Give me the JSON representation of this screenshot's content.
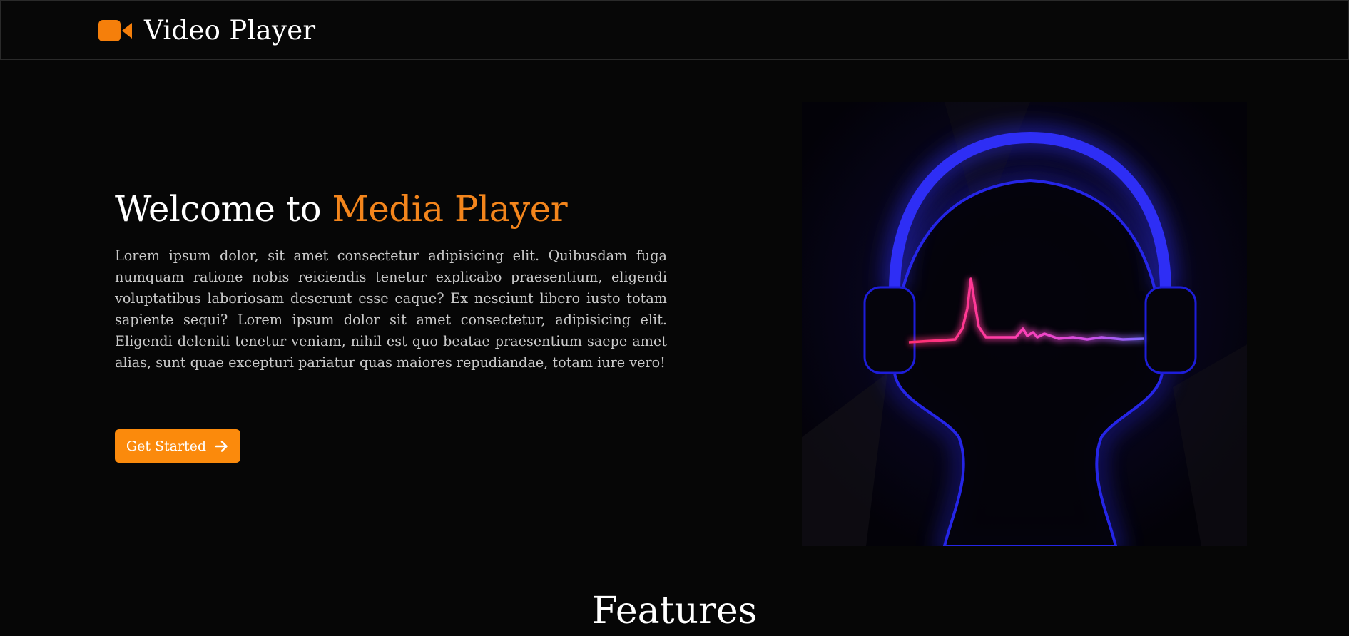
{
  "navbar": {
    "brand_icon": "video-camera-icon",
    "brand_title": "Video Player",
    "accent_color": "#f57f0b"
  },
  "hero": {
    "title_prefix": "Welcome to ",
    "title_accent": "Media Player",
    "paragraph": "Lorem ipsum dolor, sit amet consectetur adipisicing elit. Quibusdam fuga numquam ratione nobis reiciendis tenetur explicabo praesentium, eligendi voluptatibus laboriosam deserunt esse eaque? Ex nesciunt libero iusto totam sapiente sequi? Lorem ipsum dolor sit amet consectetur, adipisicing elit. Eligendi deleniti tenetur veniam, nihil est quo beatae praesentium saepe amet alias, sunt quae excepturi pariatur quas maiores repudiandae, totam iure vero!",
    "cta_label": "Get Started",
    "cta_icon": "arrow-right-icon",
    "image_subject": "neon-headphones-soundwave-illustration"
  },
  "features": {
    "title": "Features"
  }
}
